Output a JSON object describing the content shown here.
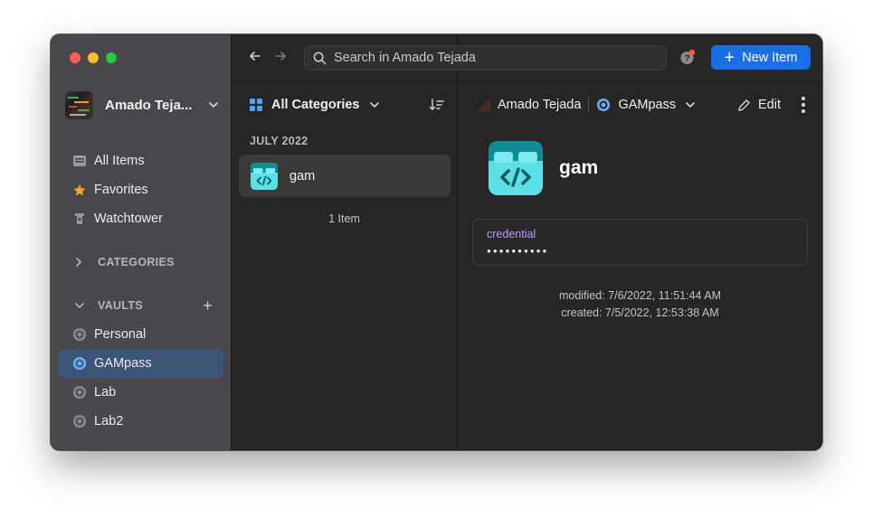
{
  "toolbar": {
    "search_placeholder": "Search in Amado Tejada",
    "new_item_label": "New Item"
  },
  "sidebar": {
    "account_name": "Amado Teja...",
    "items": [
      {
        "label": "All Items",
        "icon": "all-items-icon"
      },
      {
        "label": "Favorites",
        "icon": "star-icon"
      },
      {
        "label": "Watchtower",
        "icon": "watchtower-icon"
      }
    ],
    "categories_label": "CATEGORIES",
    "vaults_label": "VAULTS",
    "vaults": [
      {
        "label": "Personal",
        "icon": "vault-icon"
      },
      {
        "label": "GAMpass",
        "icon": "vault-icon",
        "active": true
      },
      {
        "label": "Lab",
        "icon": "vault-icon"
      },
      {
        "label": "Lab2",
        "icon": "vault-icon"
      }
    ]
  },
  "list": {
    "filter_label": "All Categories",
    "group_label": "JULY 2022",
    "items": [
      {
        "name": "gam"
      }
    ],
    "count_label": "1 Item"
  },
  "detail": {
    "account_name": "Amado Tejada",
    "vault_name": "GAMpass",
    "edit_label": "Edit",
    "item_title": "gam",
    "field_label": "credential",
    "field_value": "●●●●●●●●●●",
    "modified": "modified: 7/6/2022, 11:51:44 AM",
    "created": "created: 7/5/2022, 12:53:38 AM"
  },
  "colors": {
    "accent": "#1a6ee6",
    "sidebar_bg": "#4a474c",
    "active_row": "#3c5475",
    "field_label": "#b99df7",
    "item_icon": "#5ce0e6"
  }
}
